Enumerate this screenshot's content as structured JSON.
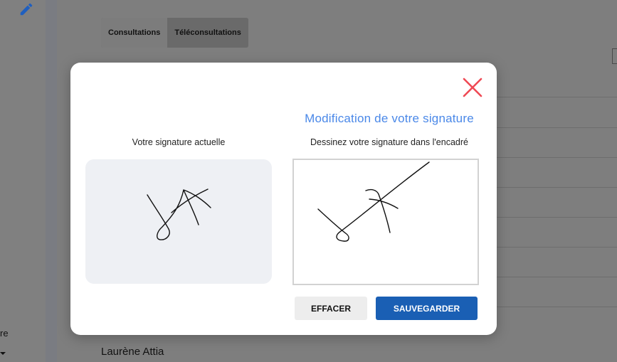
{
  "background": {
    "tabs": [
      "Consultations",
      "Téléconsultations"
    ],
    "sidebar_partial_text": "re",
    "patient_name": "Laurène Attia"
  },
  "icons": {
    "edit": "pencil-icon",
    "close": "close-icon"
  },
  "modal": {
    "title": "Modification de votre signature",
    "current_label": "Votre signature actuelle",
    "draw_label": "Dessinez votre signature dans l'encadré",
    "clear_button": "EFFACER",
    "save_button": "SAUVEGARDER"
  },
  "colors": {
    "accent": "#4a88e8",
    "primary_button": "#1a5fb4",
    "close": "#ef4a55",
    "edit_icon": "#1f5fbf"
  }
}
